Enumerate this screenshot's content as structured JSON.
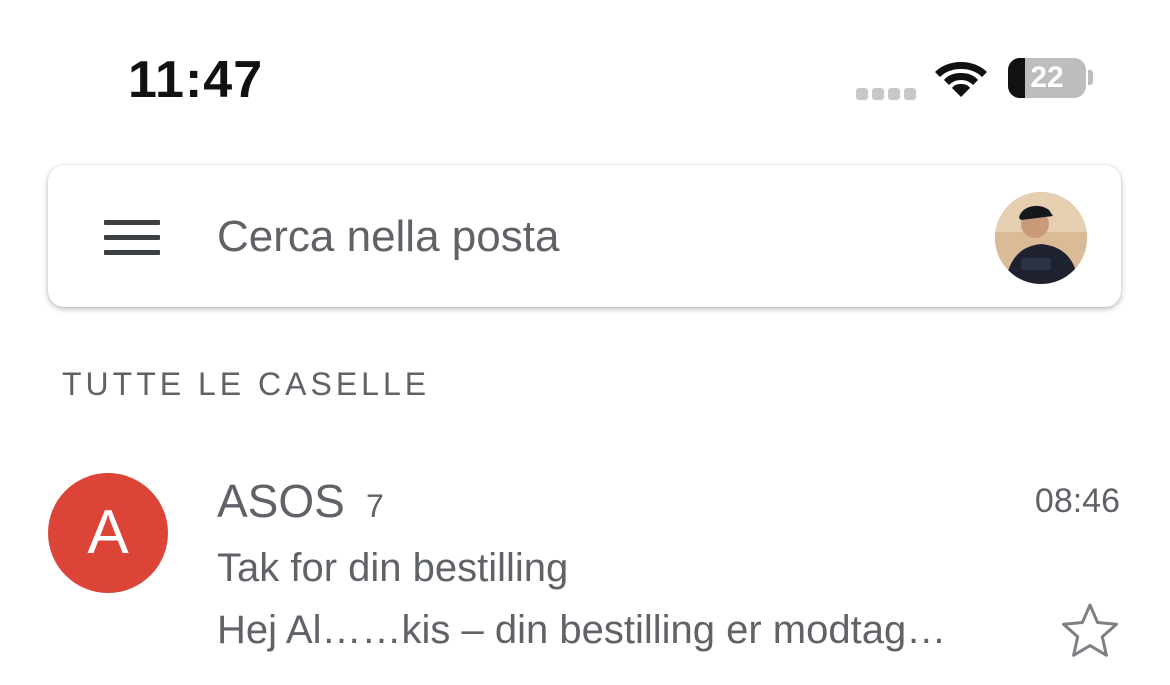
{
  "status_bar": {
    "time": "11:47",
    "battery_percent": "22",
    "battery_level": 0.22,
    "icons": [
      "cellular-signal-icon",
      "wifi-icon",
      "battery-icon"
    ]
  },
  "search": {
    "placeholder": "Cerca nella posta",
    "menu_icon": "hamburger-menu-icon",
    "avatar": "account-avatar"
  },
  "section_header": "TUTTE LE CASELLE",
  "messages": [
    {
      "avatar_letter": "A",
      "avatar_color": "#db4437",
      "sender": "ASOS",
      "thread_count": "7",
      "time": "08:46",
      "subject": "Tak for din bestilling",
      "preview": "Hej Al……kis – din bestilling er modtag…",
      "starred": false
    }
  ],
  "colors": {
    "text_secondary": "#5f6368",
    "avatar_red": "#db4437"
  }
}
